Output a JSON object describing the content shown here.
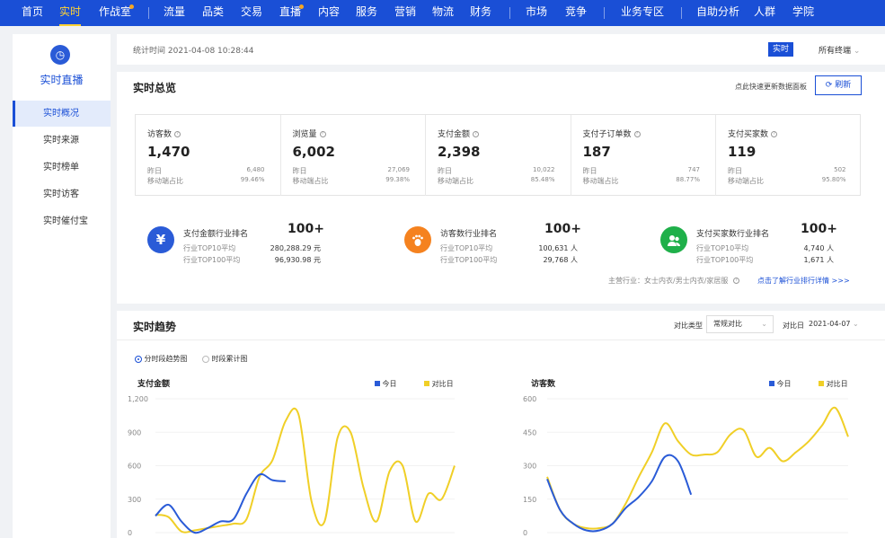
{
  "topnav": {
    "items": [
      "首页",
      "实时",
      "作战室",
      "流量",
      "品类",
      "交易",
      "直播",
      "内容",
      "服务",
      "营销",
      "物流",
      "财务",
      "市场",
      "竞争",
      "业务专区",
      "自助分析",
      "人群",
      "学院"
    ],
    "active": "实时"
  },
  "sidebar": {
    "title": "实时直播",
    "items": [
      "实时概况",
      "实时来源",
      "实时榜单",
      "实时访客",
      "实时催付宝"
    ]
  },
  "status_bar": {
    "stat_time": "统计时间 2021-04-08 10:28:44",
    "realtime_button": "实时",
    "terminal_select": "所有终端"
  },
  "overview": {
    "title": "实时总览",
    "refresh_hint": "点此快速更新数据面板",
    "refresh_button": "刷新",
    "metrics": [
      {
        "label": "访客数",
        "value": "1,470",
        "sub1": "昨日",
        "sub1v": "6,480",
        "sub2": "移动端占比",
        "sub2v": "99.46%"
      },
      {
        "label": "浏览量",
        "value": "6,002",
        "sub1": "昨日",
        "sub1v": "27,069",
        "sub2": "移动端占比",
        "sub2v": "99.38%"
      },
      {
        "label": "支付金额",
        "value": "2,398",
        "sub1": "昨日",
        "sub1v": "10,022",
        "sub2": "移动端占比",
        "sub2v": "85.48%"
      },
      {
        "label": "支付子订单数",
        "value": "187",
        "sub1": "昨日",
        "sub1v": "747",
        "sub2": "移动端占比",
        "sub2v": "88.77%"
      },
      {
        "label": "支付买家数",
        "value": "119",
        "sub1": "昨日",
        "sub1v": "502",
        "sub2": "移动端占比",
        "sub2v": "95.80%"
      }
    ],
    "ranks": [
      {
        "title": "支付金额行业排名",
        "rank": "100+",
        "l1": "行业TOP10平均",
        "v1": "280,288.29 元",
        "l2": "行业TOP100平均",
        "v2": "96,930.98 元",
        "color": "#2a5bd7",
        "icon": "¥"
      },
      {
        "title": "访客数行业排名",
        "rank": "100+",
        "l1": "行业TOP10平均",
        "v1": "100,631 人",
        "l2": "行业TOP100平均",
        "v2": "29,768 人",
        "color": "#f5821f",
        "icon": "foot"
      },
      {
        "title": "支付买家数行业排名",
        "rank": "100+",
        "l1": "行业TOP10平均",
        "v1": "4,740 人",
        "l2": "行业TOP100平均",
        "v2": "1,671 人",
        "color": "#1fb04a",
        "icon": "user"
      }
    ],
    "industry_text": "主营行业：女士内衣/男士内衣/家居服",
    "industry_link": "点击了解行业排行详情 >>>"
  },
  "trend": {
    "title": "实时趋势",
    "compare_type_label": "对比类型",
    "compare_type_value": "常规对比",
    "compare_date_label": "对比日",
    "compare_date_value": "2021-04-07",
    "radio_options": [
      "分时段趋势图",
      "时段累计图"
    ],
    "legend_today": "今日",
    "legend_compare": "对比日",
    "colors": {
      "today": "#2a5bd7",
      "compare": "#f0cf27"
    }
  },
  "chart_data": [
    {
      "type": "line",
      "title": "支付金额",
      "ylim": [
        0,
        1200
      ],
      "yticks": [
        "0",
        "300",
        "600",
        "900",
        "1,200"
      ],
      "series": [
        {
          "name": "今日",
          "x": [
            0,
            1,
            2,
            3,
            4,
            5,
            6,
            7,
            8,
            9,
            10
          ],
          "values": [
            150,
            250,
            100,
            0,
            40,
            100,
            120,
            350,
            520,
            470,
            460
          ]
        },
        {
          "name": "对比日",
          "x": [
            0,
            1,
            2,
            3,
            4,
            5,
            6,
            7,
            8,
            9,
            10,
            11,
            12,
            13,
            14,
            15,
            16,
            17,
            18,
            19,
            20,
            21,
            22,
            23
          ],
          "values": [
            160,
            140,
            10,
            20,
            40,
            60,
            80,
            120,
            500,
            650,
            1000,
            1060,
            280,
            100,
            850,
            900,
            400,
            100,
            550,
            600,
            100,
            350,
            300,
            600
          ]
        }
      ]
    },
    {
      "type": "line",
      "title": "访客数",
      "ylim": [
        0,
        600
      ],
      "yticks": [
        "0",
        "150",
        "300",
        "450",
        "600"
      ],
      "series": [
        {
          "name": "今日",
          "x": [
            0,
            1,
            2,
            3,
            4,
            5,
            6,
            7,
            8,
            9,
            10,
            11
          ],
          "values": [
            240,
            100,
            40,
            10,
            10,
            40,
            110,
            160,
            230,
            340,
            320,
            170
          ]
        },
        {
          "name": "对比日",
          "x": [
            0,
            1,
            2,
            3,
            4,
            5,
            6,
            7,
            8,
            9,
            10,
            11,
            12,
            13,
            14,
            15,
            16,
            17,
            18,
            19,
            20,
            21,
            22,
            23
          ],
          "values": [
            250,
            100,
            40,
            20,
            20,
            40,
            130,
            250,
            360,
            490,
            410,
            350,
            350,
            360,
            440,
            460,
            340,
            380,
            320,
            360,
            410,
            480,
            560,
            430
          ]
        }
      ]
    }
  ]
}
